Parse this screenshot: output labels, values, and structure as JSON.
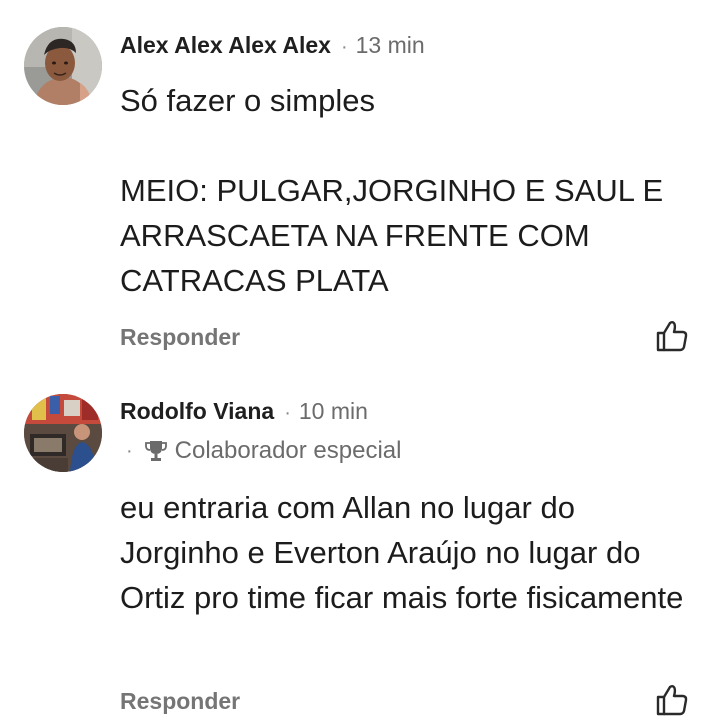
{
  "comments": [
    {
      "author": "Alex Alex Alex Alex",
      "separator": "·",
      "time": "13 min",
      "text": "Só fazer o simples\n\nMEIO: PULGAR,JORGINHO E SAUL E ARRASCAETA NA FRENTE COM CATRACAS PLATA",
      "reply_label": "Responder",
      "avatar_icon": "user-photo-avatar",
      "like_icon": "thumbs-up-icon"
    },
    {
      "author": "Rodolfo Viana",
      "separator": "·",
      "time": "10 min",
      "badge_separator": "·",
      "badge_icon": "trophy-icon",
      "badge_label": "Colaborador especial",
      "text": "eu entraria com Allan no lugar do Jorginho e Everton Araújo no lugar do Ortiz pro time ficar mais forte fisicamente",
      "reply_label": "Responder",
      "avatar_icon": "user-photo-avatar",
      "like_icon": "thumbs-up-icon"
    }
  ],
  "colors": {
    "text_primary": "#1c1c1c",
    "text_secondary": "#6b6b6b",
    "reply": "#757575",
    "background": "#ffffff"
  }
}
